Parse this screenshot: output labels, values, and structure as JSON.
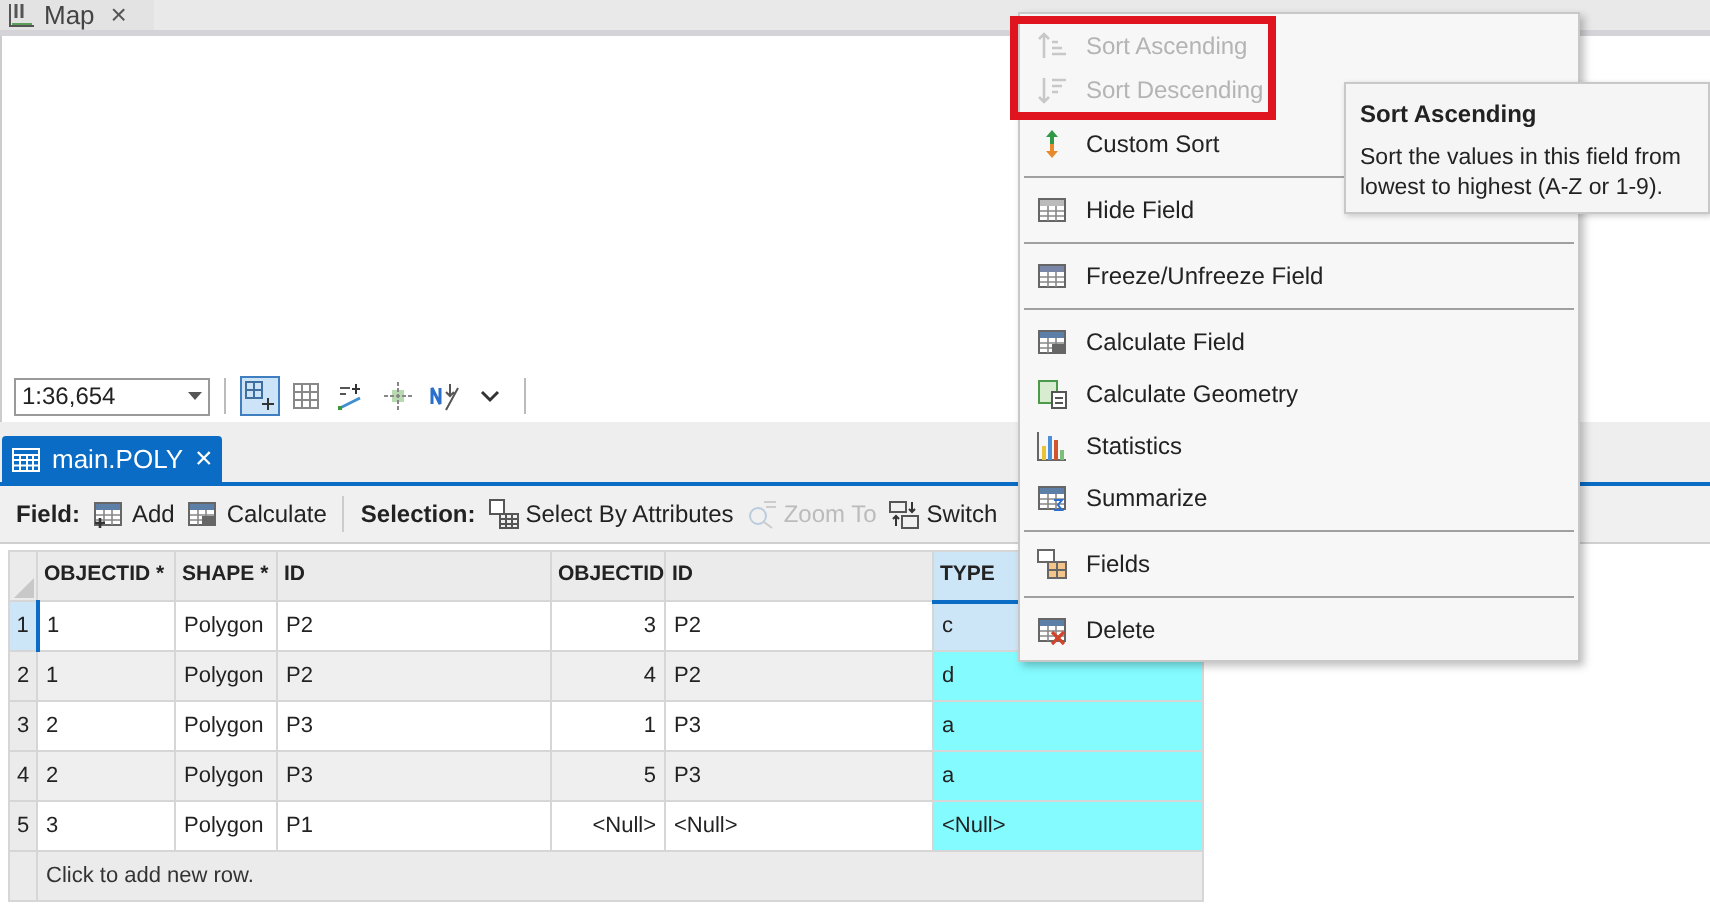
{
  "map_tab": {
    "title": "Map",
    "close": "×"
  },
  "map_toolbar": {
    "scale": "1:36,654",
    "tools": [
      {
        "kind": "grid-plus",
        "selected": true
      },
      {
        "kind": "grid",
        "selected": false
      },
      {
        "kind": "snap",
        "selected": false
      },
      {
        "kind": "cross",
        "selected": false
      },
      {
        "kind": "north",
        "selected": false
      },
      {
        "kind": "more",
        "selected": false
      }
    ]
  },
  "table_tab": {
    "title": "main.POLY",
    "close": "×"
  },
  "table_toolbar": {
    "field_label": "Field:",
    "field_buttons": [
      {
        "label": "Add",
        "disabled": false
      },
      {
        "label": "Calculate",
        "disabled": false
      }
    ],
    "selection_label": "Selection:",
    "selection_buttons": [
      {
        "label": "Select By Attributes",
        "disabled": false
      },
      {
        "label": "Zoom To",
        "disabled": true
      },
      {
        "label": "Switch",
        "disabled": false
      }
    ]
  },
  "table": {
    "columns": [
      {
        "name": "OBJECTID *",
        "kind": "text",
        "selected": false
      },
      {
        "name": "SHAPE *",
        "kind": "text",
        "selected": false
      },
      {
        "name": "ID",
        "kind": "text",
        "selected": false
      },
      {
        "name": "OBJECTID",
        "kind": "number",
        "selected": false
      },
      {
        "name": "ID",
        "kind": "text",
        "selected": false
      },
      {
        "name": "TYPE",
        "kind": "text",
        "selected": true
      }
    ],
    "rows": [
      {
        "number": "1",
        "selected": true,
        "cells": [
          "1",
          "Polygon",
          "P2",
          "3",
          "P2",
          "c"
        ]
      },
      {
        "number": "2",
        "selected": false,
        "cells": [
          "1",
          "Polygon",
          "P2",
          "4",
          "P2",
          "d"
        ]
      },
      {
        "number": "3",
        "selected": false,
        "cells": [
          "2",
          "Polygon",
          "P3",
          "1",
          "P3",
          "a"
        ]
      },
      {
        "number": "4",
        "selected": false,
        "cells": [
          "2",
          "Polygon",
          "P3",
          "5",
          "P3",
          "a"
        ]
      },
      {
        "number": "5",
        "selected": false,
        "cells": [
          "3",
          "Polygon",
          "P1",
          "<Null>",
          "<Null>",
          "<Null>"
        ]
      }
    ],
    "new_row": "Click to add new row."
  },
  "context_menu": {
    "items": [
      {
        "label": "Sort Ascending",
        "kind": "sort-asc",
        "disabled": true,
        "highlighted": true,
        "separator_before": false
      },
      {
        "label": "Sort Descending",
        "kind": "sort-desc",
        "disabled": true,
        "highlighted": true,
        "separator_before": false
      },
      {
        "label": "Custom Sort",
        "kind": "custom-sort",
        "disabled": false,
        "highlighted": false,
        "separator_before": false
      },
      {
        "label": "Hide Field",
        "kind": "hide",
        "disabled": false,
        "highlighted": false,
        "separator_before": true
      },
      {
        "label": "Freeze/Unfreeze Field",
        "kind": "freeze",
        "disabled": false,
        "highlighted": false,
        "separator_before": true
      },
      {
        "label": "Calculate Field",
        "kind": "calc",
        "disabled": false,
        "highlighted": false,
        "separator_before": true
      },
      {
        "label": "Calculate Geometry",
        "kind": "geometry",
        "disabled": false,
        "highlighted": false,
        "separator_before": false
      },
      {
        "label": "Statistics",
        "kind": "stats",
        "disabled": false,
        "highlighted": false,
        "separator_before": false
      },
      {
        "label": "Summarize",
        "kind": "summarize",
        "disabled": false,
        "highlighted": false,
        "separator_before": false
      },
      {
        "label": "Fields",
        "kind": "fields",
        "disabled": false,
        "highlighted": false,
        "separator_before": true
      },
      {
        "label": "Delete",
        "kind": "delete",
        "disabled": false,
        "highlighted": false,
        "separator_before": true
      }
    ]
  },
  "tooltip": {
    "title": "Sort Ascending",
    "text": "Sort the values in this field from lowest to highest (A-Z or 1-9)."
  }
}
